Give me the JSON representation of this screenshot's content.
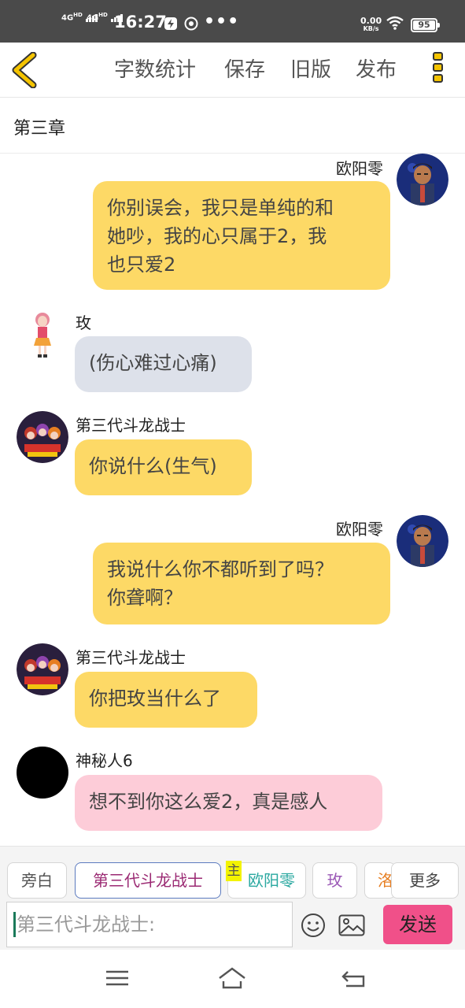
{
  "status_bar": {
    "net1": "4G",
    "net1_sup": "HD",
    "net2": "4G",
    "net2_sup": "HD",
    "time": "16:27",
    "dots": "•••",
    "speed_value": "0.00",
    "speed_unit": "KB/s",
    "battery": "95"
  },
  "toolbar": {
    "word_count": "字数统计",
    "save": "保存",
    "old_version": "旧版",
    "publish": "发布"
  },
  "chapter_title": "第三章",
  "messages": [
    {
      "sender": "欧阳零",
      "text_lines": [
        "你别误会，我只是单纯的和",
        "她吵，我的心只属于2，我",
        "也只爱2"
      ]
    },
    {
      "sender": "玫",
      "text_lines": [
        "(伤心难过心痛)"
      ]
    },
    {
      "sender": "第三代斗龙战士",
      "text_lines": [
        "你说什么(生气)"
      ]
    },
    {
      "sender": "欧阳零",
      "text_lines": [
        "我说什么你不都听到了吗？",
        "你聋啊？"
      ]
    },
    {
      "sender": "第三代斗龙战士",
      "text_lines": [
        "你把玫当什么了"
      ]
    },
    {
      "sender": "神秘人6",
      "text_lines": [
        "想不到你这么爱2，真是感人"
      ]
    }
  ],
  "roles": {
    "narration": "旁白",
    "selected": "第三代斗龙战士",
    "main_badge": "主",
    "ouyang": "欧阳零",
    "mei": "玫",
    "cut": "洛",
    "more": "更多"
  },
  "input": {
    "placeholder": "第三代斗龙战士:"
  },
  "send": "发送",
  "colors": {
    "bubble_yellow": "#fdd966",
    "bubble_gray": "#dde1ea",
    "bubble_pink": "#fdccd8",
    "send_button": "#f05089",
    "status_bar": "#4a4a4a",
    "ouyang_chip_text": "#2aa8a0",
    "mei_chip_text": "#9b59b6",
    "cut_chip_text": "#e67e22"
  }
}
